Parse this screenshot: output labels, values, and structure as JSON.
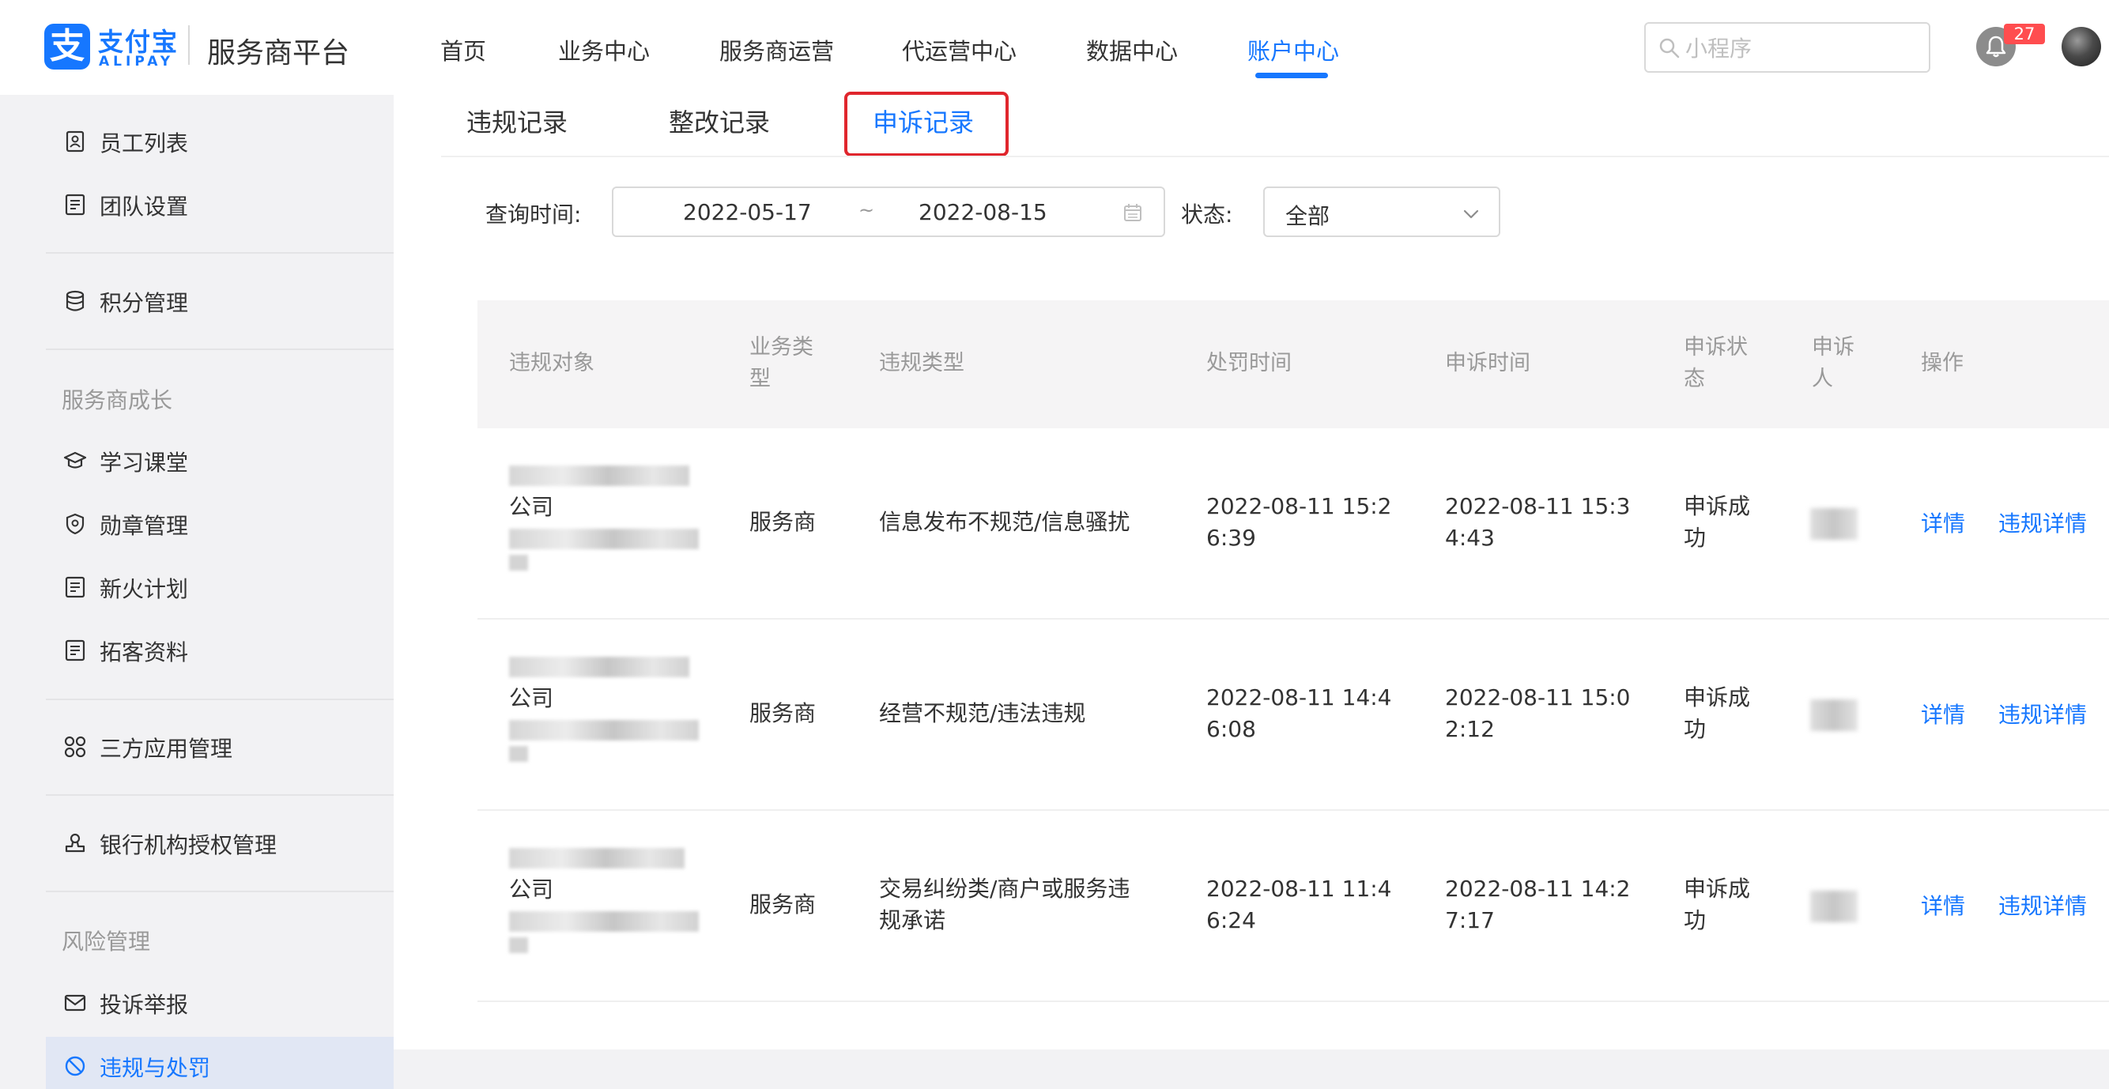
{
  "header": {
    "logo_mark": "支",
    "logo_cn": "支付宝",
    "logo_en": "ALIPAY",
    "platform_title": "服务商平台",
    "nav": [
      "首页",
      "业务中心",
      "服务商运营",
      "代运营中心",
      "数据中心",
      "账户中心"
    ],
    "active_nav": "账户中心",
    "search_placeholder": "小程序",
    "notification_count": "27",
    "accent_color": "#1677ff"
  },
  "sidebar": {
    "items_top": [
      "员工列表",
      "团队设置",
      "积分管理"
    ],
    "group_growth": "服务商成长",
    "items_growth": [
      "学习课堂",
      "勋章管理",
      "新火计划",
      "拓客资料"
    ],
    "items_misc": [
      "三方应用管理",
      "银行机构授权管理"
    ],
    "group_risk": "风险管理",
    "items_risk": [
      "投诉举报",
      "违规与处罚"
    ],
    "active_item": "违规与处罚"
  },
  "tabs": [
    "违规记录",
    "整改记录",
    "申诉记录"
  ],
  "active_tab": "申诉记录",
  "filters": {
    "query_time_label": "查询时间:",
    "date_start": "2022-05-17",
    "date_separator": "~",
    "date_end": "2022-08-15",
    "status_label": "状态:",
    "status_value": "全部"
  },
  "table": {
    "columns": [
      "违规对象",
      "业务类型",
      "违规类型",
      "处罚时间",
      "申诉时间",
      "申诉状态",
      "申诉人",
      "操作"
    ],
    "rows": [
      {
        "object_visible": "公司",
        "business_type": "服务商",
        "violation_type": "信息发布不规范/信息骚扰",
        "penalty_time": "2022-08-11 15:26:39",
        "appeal_time": "2022-08-11 15:34:43",
        "appeal_status": "申诉成功",
        "actions": [
          "详情",
          "违规详情"
        ]
      },
      {
        "object_visible": "公司",
        "business_type": "服务商",
        "violation_type": "经营不规范/违法违规",
        "penalty_time": "2022-08-11 14:46:08",
        "appeal_time": "2022-08-11 15:02:12",
        "appeal_status": "申诉成功",
        "actions": [
          "详情",
          "违规详情"
        ]
      },
      {
        "object_visible": "公司",
        "business_type": "服务商",
        "violation_type": "交易纠纷类/商户或服务违规承诺",
        "penalty_time": "2022-08-11 11:46:24",
        "appeal_time": "2022-08-11 14:27:17",
        "appeal_status": "申诉成功",
        "actions": [
          "详情",
          "违规详情"
        ]
      }
    ]
  },
  "highlight_color": "#e0262d"
}
